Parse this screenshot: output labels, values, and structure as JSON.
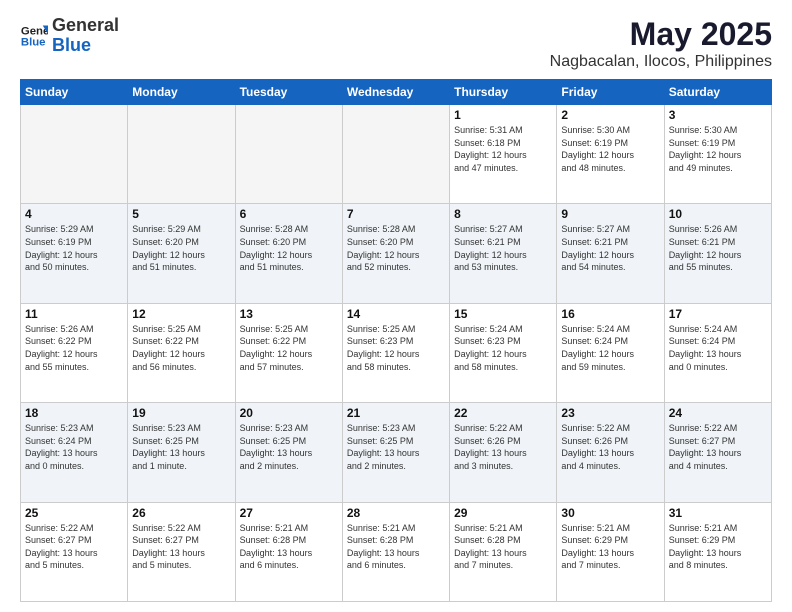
{
  "header": {
    "logo_line1": "General",
    "logo_line2": "Blue",
    "title": "May 2025",
    "subtitle": "Nagbacalan, Ilocos, Philippines"
  },
  "weekdays": [
    "Sunday",
    "Monday",
    "Tuesday",
    "Wednesday",
    "Thursday",
    "Friday",
    "Saturday"
  ],
  "weeks": [
    [
      {
        "day": "",
        "info": ""
      },
      {
        "day": "",
        "info": ""
      },
      {
        "day": "",
        "info": ""
      },
      {
        "day": "",
        "info": ""
      },
      {
        "day": "1",
        "info": "Sunrise: 5:31 AM\nSunset: 6:18 PM\nDaylight: 12 hours\nand 47 minutes."
      },
      {
        "day": "2",
        "info": "Sunrise: 5:30 AM\nSunset: 6:19 PM\nDaylight: 12 hours\nand 48 minutes."
      },
      {
        "day": "3",
        "info": "Sunrise: 5:30 AM\nSunset: 6:19 PM\nDaylight: 12 hours\nand 49 minutes."
      }
    ],
    [
      {
        "day": "4",
        "info": "Sunrise: 5:29 AM\nSunset: 6:19 PM\nDaylight: 12 hours\nand 50 minutes."
      },
      {
        "day": "5",
        "info": "Sunrise: 5:29 AM\nSunset: 6:20 PM\nDaylight: 12 hours\nand 51 minutes."
      },
      {
        "day": "6",
        "info": "Sunrise: 5:28 AM\nSunset: 6:20 PM\nDaylight: 12 hours\nand 51 minutes."
      },
      {
        "day": "7",
        "info": "Sunrise: 5:28 AM\nSunset: 6:20 PM\nDaylight: 12 hours\nand 52 minutes."
      },
      {
        "day": "8",
        "info": "Sunrise: 5:27 AM\nSunset: 6:21 PM\nDaylight: 12 hours\nand 53 minutes."
      },
      {
        "day": "9",
        "info": "Sunrise: 5:27 AM\nSunset: 6:21 PM\nDaylight: 12 hours\nand 54 minutes."
      },
      {
        "day": "10",
        "info": "Sunrise: 5:26 AM\nSunset: 6:21 PM\nDaylight: 12 hours\nand 55 minutes."
      }
    ],
    [
      {
        "day": "11",
        "info": "Sunrise: 5:26 AM\nSunset: 6:22 PM\nDaylight: 12 hours\nand 55 minutes."
      },
      {
        "day": "12",
        "info": "Sunrise: 5:25 AM\nSunset: 6:22 PM\nDaylight: 12 hours\nand 56 minutes."
      },
      {
        "day": "13",
        "info": "Sunrise: 5:25 AM\nSunset: 6:22 PM\nDaylight: 12 hours\nand 57 minutes."
      },
      {
        "day": "14",
        "info": "Sunrise: 5:25 AM\nSunset: 6:23 PM\nDaylight: 12 hours\nand 58 minutes."
      },
      {
        "day": "15",
        "info": "Sunrise: 5:24 AM\nSunset: 6:23 PM\nDaylight: 12 hours\nand 58 minutes."
      },
      {
        "day": "16",
        "info": "Sunrise: 5:24 AM\nSunset: 6:24 PM\nDaylight: 12 hours\nand 59 minutes."
      },
      {
        "day": "17",
        "info": "Sunrise: 5:24 AM\nSunset: 6:24 PM\nDaylight: 13 hours\nand 0 minutes."
      }
    ],
    [
      {
        "day": "18",
        "info": "Sunrise: 5:23 AM\nSunset: 6:24 PM\nDaylight: 13 hours\nand 0 minutes."
      },
      {
        "day": "19",
        "info": "Sunrise: 5:23 AM\nSunset: 6:25 PM\nDaylight: 13 hours\nand 1 minute."
      },
      {
        "day": "20",
        "info": "Sunrise: 5:23 AM\nSunset: 6:25 PM\nDaylight: 13 hours\nand 2 minutes."
      },
      {
        "day": "21",
        "info": "Sunrise: 5:23 AM\nSunset: 6:25 PM\nDaylight: 13 hours\nand 2 minutes."
      },
      {
        "day": "22",
        "info": "Sunrise: 5:22 AM\nSunset: 6:26 PM\nDaylight: 13 hours\nand 3 minutes."
      },
      {
        "day": "23",
        "info": "Sunrise: 5:22 AM\nSunset: 6:26 PM\nDaylight: 13 hours\nand 4 minutes."
      },
      {
        "day": "24",
        "info": "Sunrise: 5:22 AM\nSunset: 6:27 PM\nDaylight: 13 hours\nand 4 minutes."
      }
    ],
    [
      {
        "day": "25",
        "info": "Sunrise: 5:22 AM\nSunset: 6:27 PM\nDaylight: 13 hours\nand 5 minutes."
      },
      {
        "day": "26",
        "info": "Sunrise: 5:22 AM\nSunset: 6:27 PM\nDaylight: 13 hours\nand 5 minutes."
      },
      {
        "day": "27",
        "info": "Sunrise: 5:21 AM\nSunset: 6:28 PM\nDaylight: 13 hours\nand 6 minutes."
      },
      {
        "day": "28",
        "info": "Sunrise: 5:21 AM\nSunset: 6:28 PM\nDaylight: 13 hours\nand 6 minutes."
      },
      {
        "day": "29",
        "info": "Sunrise: 5:21 AM\nSunset: 6:28 PM\nDaylight: 13 hours\nand 7 minutes."
      },
      {
        "day": "30",
        "info": "Sunrise: 5:21 AM\nSunset: 6:29 PM\nDaylight: 13 hours\nand 7 minutes."
      },
      {
        "day": "31",
        "info": "Sunrise: 5:21 AM\nSunset: 6:29 PM\nDaylight: 13 hours\nand 8 minutes."
      }
    ]
  ]
}
